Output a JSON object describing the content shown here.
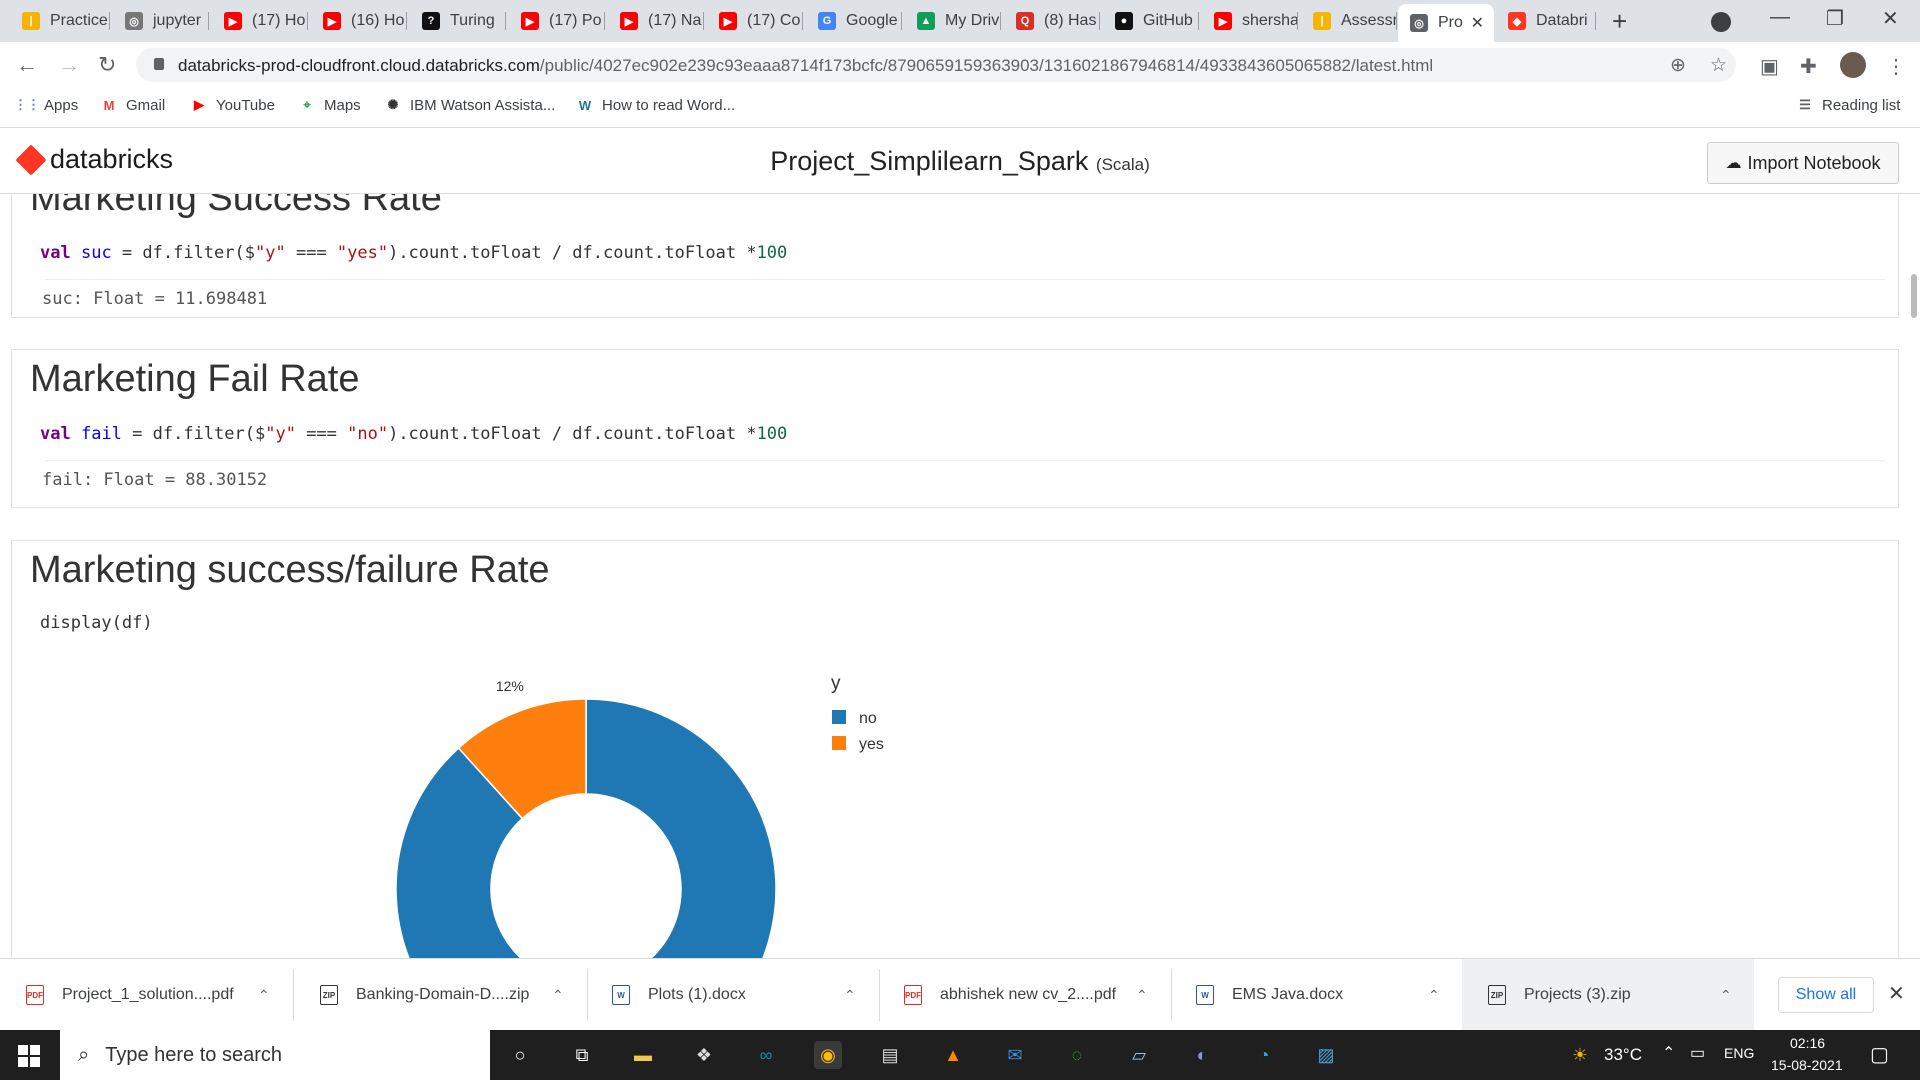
{
  "browser": {
    "tabs": [
      {
        "label": "Practice",
        "color": "#f4b400",
        "glyph": "|"
      },
      {
        "label": "jupyter",
        "color": "#777777",
        "glyph": "◎"
      },
      {
        "label": "(17) Ho",
        "color": "#ff0000",
        "glyph": "▶"
      },
      {
        "label": "(16) Ho",
        "color": "#ff0000",
        "glyph": "▶"
      },
      {
        "label": "Turing",
        "color": "#111111",
        "glyph": "?"
      },
      {
        "label": "(17) Po",
        "color": "#ff0000",
        "glyph": "▶"
      },
      {
        "label": "(17) Na",
        "color": "#ff0000",
        "glyph": "▶"
      },
      {
        "label": "(17) Co",
        "color": "#ff0000",
        "glyph": "▶"
      },
      {
        "label": "Google",
        "color": "#4285f4",
        "glyph": "G"
      },
      {
        "label": "My Driv",
        "color": "#0f9d58",
        "glyph": "▲"
      },
      {
        "label": "(8) Has",
        "color": "#d93025",
        "glyph": "Q"
      },
      {
        "label": "GitHub",
        "color": "#111111",
        "glyph": "●"
      },
      {
        "label": "shersha",
        "color": "#ff0000",
        "glyph": "▶"
      },
      {
        "label": "Assessr",
        "color": "#f4b400",
        "glyph": "|"
      },
      {
        "label": "Pro",
        "color": "#5f6368",
        "glyph": "◎"
      },
      {
        "label": "Databri",
        "color": "#ff3621",
        "glyph": "◆"
      }
    ],
    "url_domain": "databricks-prod-cloudfront.cloud.databricks.com",
    "url_path": "/public/4027ec902e239c93eaaa8714f173bcfc/8790659159363903/1316021867946814/4933843605065882/latest.html",
    "bookmarks": [
      {
        "label": "Apps",
        "glyph": "⋮⋮",
        "color": "#4285f4"
      },
      {
        "label": "Gmail",
        "glyph": "M",
        "color": "#ea4335"
      },
      {
        "label": "YouTube",
        "glyph": "▶",
        "color": "#ff0000"
      },
      {
        "label": "Maps",
        "glyph": "⌖",
        "color": "#34a853"
      },
      {
        "label": "IBM Watson Assista...",
        "glyph": "✺",
        "color": "#333333"
      },
      {
        "label": "How to read Word...",
        "glyph": "W",
        "color": "#21759b"
      }
    ],
    "reading_list": "Reading list"
  },
  "notebook": {
    "logo": "databricks",
    "title": "Project_Simplilearn_Spark",
    "language": "(Scala)",
    "import_label": "Import Notebook",
    "cells": {
      "c1": {
        "heading": "Marketing Success Rate",
        "code": {
          "kw": "val",
          "name": "suc",
          "a": " = df.filter($",
          "s1": "\"y\"",
          "b": " === ",
          "s2": "\"yes\"",
          "c": ").count.toFloat / df.count.toFloat ",
          "d": "*",
          "num": "100"
        },
        "output": "suc: Float = 11.698481"
      },
      "c2": {
        "heading": "Marketing Fail Rate",
        "code": {
          "kw": "val",
          "name": "fail",
          "a": " = df.filter($",
          "s1": "\"y\"",
          "b": " === ",
          "s2": "\"no\"",
          "c": ").count.toFloat / df.count.toFloat ",
          "d": "*",
          "num": "100"
        },
        "output": "fail: Float = 88.30152"
      },
      "c3": {
        "heading": "Marketing success/failure Rate",
        "code": "display(df)"
      }
    }
  },
  "chart_data": {
    "type": "pie",
    "donut": true,
    "legend_title": "y",
    "legend_position": "right",
    "categories": [
      "no",
      "yes"
    ],
    "values": [
      88.30152,
      11.698481
    ],
    "colors": [
      "#1f77b4",
      "#ff7f0e"
    ],
    "data_labels": [
      "",
      "12%"
    ]
  },
  "downloads": [
    {
      "label": "Project_1_solution....pdf",
      "type": "PDF",
      "color": "#d93025"
    },
    {
      "label": "Banking-Domain-D....zip",
      "type": "ZIP",
      "color": "#333333"
    },
    {
      "label": "Plots (1).docx",
      "type": "W",
      "color": "#2b579a"
    },
    {
      "label": "abhishek new cv_2....pdf",
      "type": "PDF",
      "color": "#d93025"
    },
    {
      "label": "EMS Java.docx",
      "type": "W",
      "color": "#2b579a"
    },
    {
      "label": "Projects (3).zip",
      "type": "ZIP",
      "color": "#333333"
    }
  ],
  "show_all": "Show all",
  "taskbar": {
    "search_placeholder": "Type here to search",
    "temperature": "33°C",
    "language": "ENG",
    "time": "02:16",
    "date": "15-08-2021"
  }
}
